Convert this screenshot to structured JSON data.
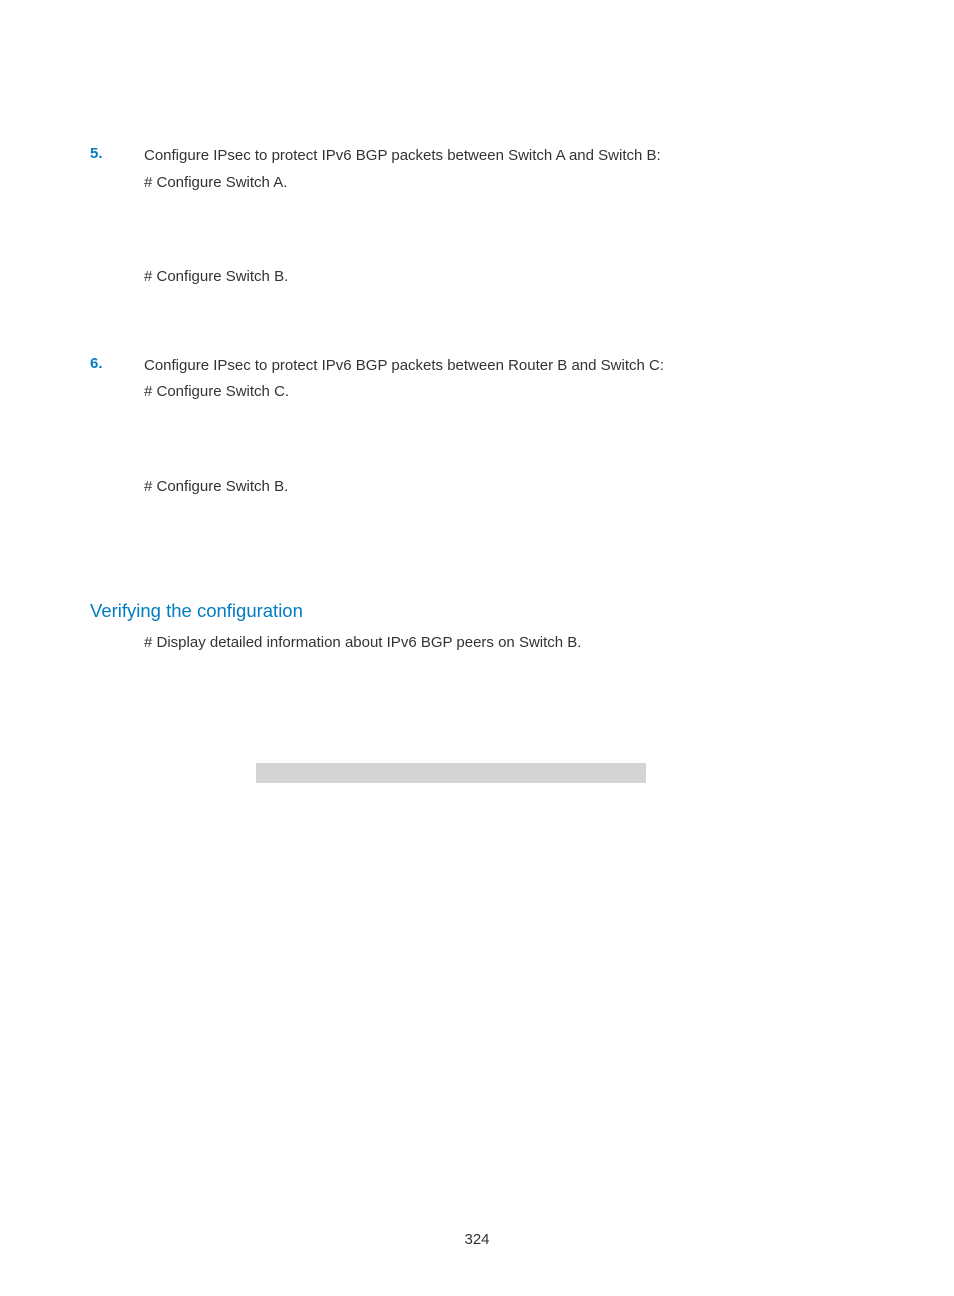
{
  "section5": {
    "number": "5.",
    "title": "Configure IPsec to protect IPv6 BGP packets between Switch A and Switch B:",
    "configA": "# Configure Switch A.",
    "configB": "# Configure Switch B."
  },
  "section6": {
    "number": "6.",
    "title": "Configure IPsec to protect IPv6 BGP packets between Router B and Switch C:",
    "configC": "# Configure Switch C.",
    "configB": "# Configure Switch B."
  },
  "verify": {
    "heading": "Verifying the configuration",
    "body": "# Display detailed information about IPv6 BGP peers on Switch B."
  },
  "pageNumber": "324"
}
